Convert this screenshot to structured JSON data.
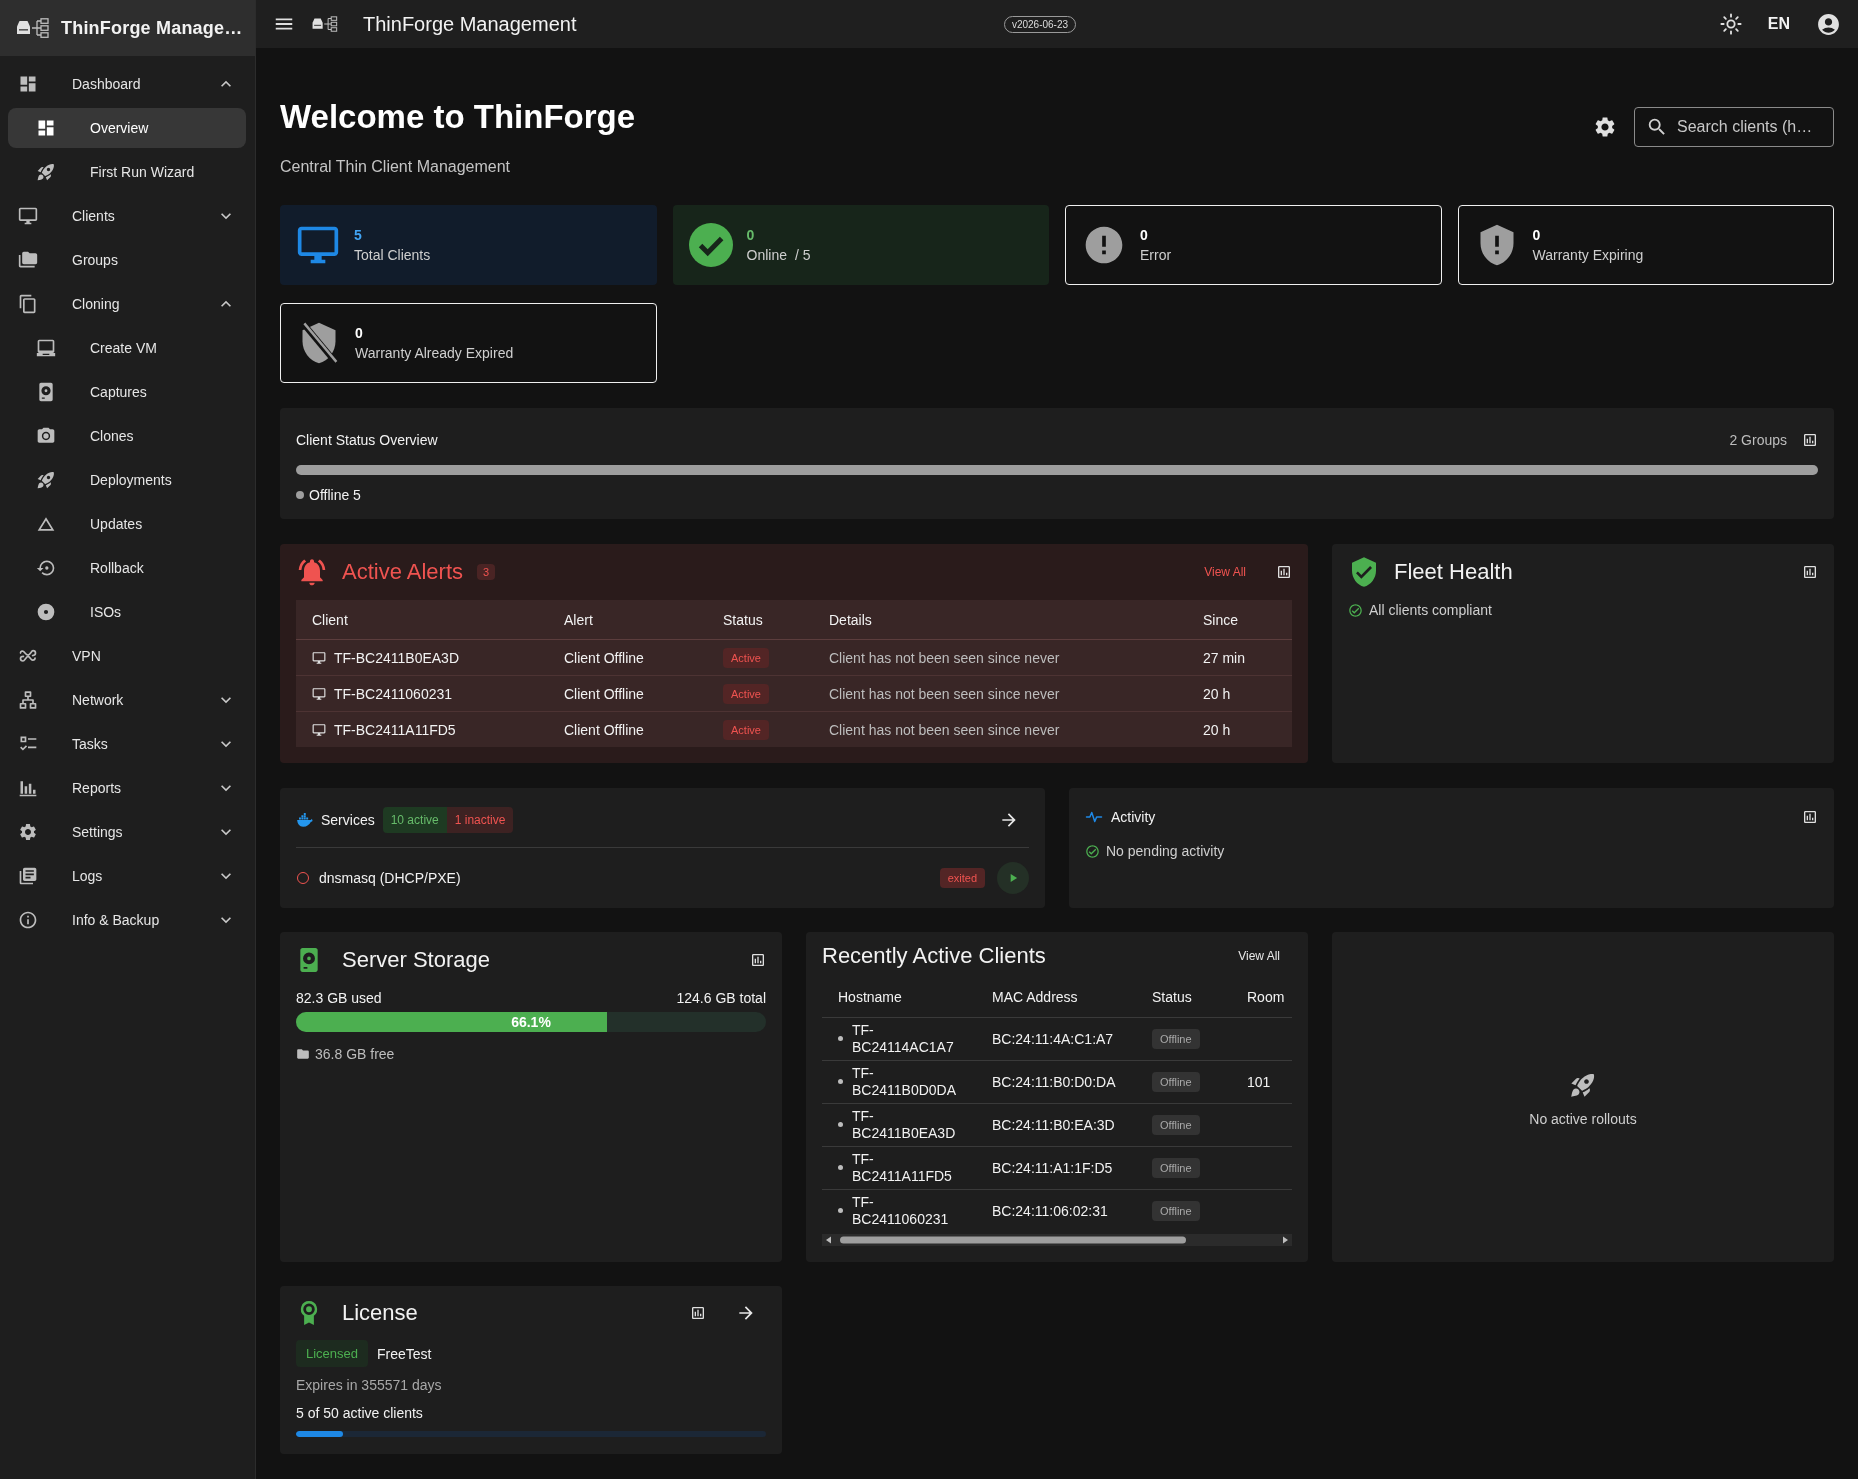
{
  "sidebar": {
    "brand": "ThinForge Manage…",
    "items": [
      {
        "label": "Dashboard",
        "kind": "section",
        "expanded": true,
        "selected": false,
        "children": [
          {
            "label": "Overview",
            "selected": true
          },
          {
            "label": "First Run Wizard",
            "selected": false
          }
        ]
      },
      {
        "label": "Clients",
        "kind": "section",
        "expanded": false,
        "selected": false
      },
      {
        "label": "Groups",
        "kind": "link",
        "selected": false
      },
      {
        "label": "Cloning",
        "kind": "section",
        "expanded": true,
        "selected": false,
        "children": [
          {
            "label": "Create VM",
            "selected": false
          },
          {
            "label": "Captures",
            "selected": false
          },
          {
            "label": "Clones",
            "selected": false
          },
          {
            "label": "Deployments",
            "selected": false
          },
          {
            "label": "Updates",
            "selected": false
          },
          {
            "label": "Rollback",
            "selected": false
          },
          {
            "label": "ISOs",
            "selected": false
          }
        ]
      },
      {
        "label": "VPN",
        "kind": "link",
        "selected": false
      },
      {
        "label": "Network",
        "kind": "section",
        "expanded": false,
        "selected": false
      },
      {
        "label": "Tasks",
        "kind": "section",
        "expanded": false,
        "selected": false
      },
      {
        "label": "Reports",
        "kind": "section",
        "expanded": false,
        "selected": false
      },
      {
        "label": "Settings",
        "kind": "section",
        "expanded": false,
        "selected": false
      },
      {
        "label": "Logs",
        "kind": "section",
        "expanded": false,
        "selected": false
      },
      {
        "label": "Info & Backup",
        "kind": "section",
        "expanded": false,
        "selected": false
      }
    ]
  },
  "top_bar": {
    "title": "ThinForge Management",
    "version": "v2026-06-23",
    "language": "EN"
  },
  "header": {
    "title": "Welcome to ThinForge",
    "subtitle": "Central Thin Client Management",
    "search": {
      "placeholder": "Search clients (h…"
    }
  },
  "stats": [
    {
      "kind": "total",
      "value": "5",
      "label": "Total Clients"
    },
    {
      "kind": "online",
      "value": "0",
      "label": "Online",
      "total": "/ 5"
    },
    {
      "kind": "error",
      "value": "0",
      "label": "Error"
    },
    {
      "kind": "warranty_expiring",
      "value": "0",
      "label": "Warranty Expiring"
    },
    {
      "kind": "warranty_expired",
      "value": "0",
      "label": "Warranty Already Expired"
    }
  ],
  "status_overview": {
    "title": "Client Status Overview",
    "groups": "2 Groups",
    "segments": [
      {
        "label": "Offline 5",
        "color": "#9e9e9e",
        "level": 1
      }
    ]
  },
  "alerts": {
    "title": "Active Alerts",
    "count": "3",
    "view_all": "View All",
    "columns": [
      "Client",
      "Alert",
      "Status",
      "Details",
      "Since"
    ],
    "rows": [
      {
        "client": "TF-BC2411B0EA3D",
        "alert": "Client Offline",
        "status": "Active",
        "details": "Client has not been seen since never",
        "since": "27 min"
      },
      {
        "client": "TF-BC2411060231",
        "alert": "Client Offline",
        "status": "Active",
        "details": "Client has not been seen since never",
        "since": "20 h"
      },
      {
        "client": "TF-BC2411A11FD5",
        "alert": "Client Offline",
        "status": "Active",
        "details": "Client has not been seen since never",
        "since": "20 h"
      }
    ]
  },
  "fleet_health": {
    "title": "Fleet Health",
    "message": "All clients compliant"
  },
  "services": {
    "title": "Services",
    "active": "10 active",
    "inactive": "1 inactive",
    "items": [
      {
        "name": "dnsmasq (DHCP/PXE)",
        "status": "exited",
        "running": false
      }
    ]
  },
  "activity": {
    "title": "Activity",
    "message": "No pending activity"
  },
  "storage": {
    "title": "Server Storage",
    "used": "82.3 GB used",
    "total": "124.6 GB total",
    "level": 0.661,
    "percent": "66.1%",
    "free": "36.8 GB free"
  },
  "recent_clients": {
    "title": "Recently Active Clients",
    "view_all": "View All",
    "columns": [
      "Hostname",
      "MAC Address",
      "Status",
      "Room"
    ],
    "rows": [
      {
        "hostname": "TF-BC24114AC1A7",
        "mac": "BC:24:11:4A:C1:A7",
        "status": "Offline",
        "online": false
      },
      {
        "hostname": "TF-BC2411B0D0DA",
        "mac": "BC:24:11:B0:D0:DA",
        "status": "Offline",
        "online": false,
        "room": "101"
      },
      {
        "hostname": "TF-BC2411B0EA3D",
        "mac": "BC:24:11:B0:EA:3D",
        "status": "Offline",
        "online": false
      },
      {
        "hostname": "TF-BC2411A11FD5",
        "mac": "BC:24:11:A1:1F:D5",
        "status": "Offline",
        "online": false
      },
      {
        "hostname": "TF-BC2411060231",
        "mac": "BC:24:11:06:02:31",
        "status": "Offline",
        "online": false
      }
    ]
  },
  "rollouts": {
    "message": "No active rollouts"
  },
  "license": {
    "title": "License",
    "status": "Licensed",
    "plan": "FreeTest",
    "expires": "Expires in 355571 days",
    "usage": "5 of 50 active clients",
    "level": 0.1
  }
}
